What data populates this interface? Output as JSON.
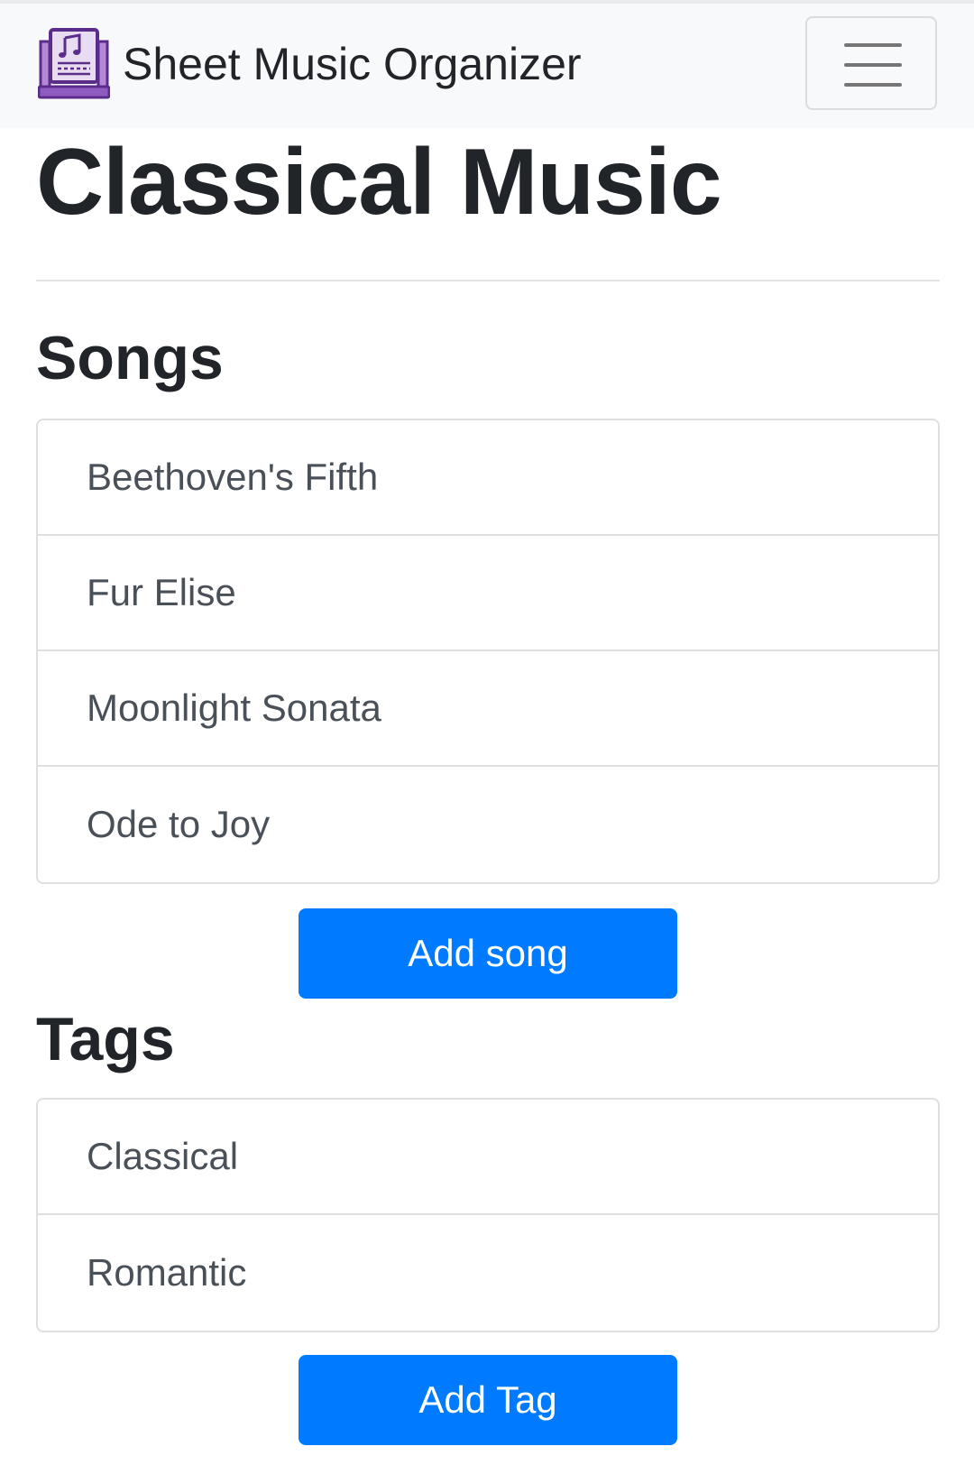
{
  "navbar": {
    "brand_text": "Sheet Music Organizer",
    "brand_icon": "sheet-music-laptop-icon",
    "menu_icon": "hamburger-menu-icon"
  },
  "page": {
    "title": "Classical Music"
  },
  "songs": {
    "heading": "Songs",
    "items": [
      {
        "label": "Beethoven's Fifth"
      },
      {
        "label": "Fur Elise"
      },
      {
        "label": "Moonlight Sonata"
      },
      {
        "label": "Ode to Joy"
      }
    ],
    "add_label": "Add song"
  },
  "tags": {
    "heading": "Tags",
    "items": [
      {
        "label": "Classical"
      },
      {
        "label": "Romantic"
      }
    ],
    "add_label": "Add Tag"
  },
  "colors": {
    "primary": "#007bff",
    "navbar_bg": "#f8f9fa",
    "logo_purple": "#6f3fa0"
  }
}
